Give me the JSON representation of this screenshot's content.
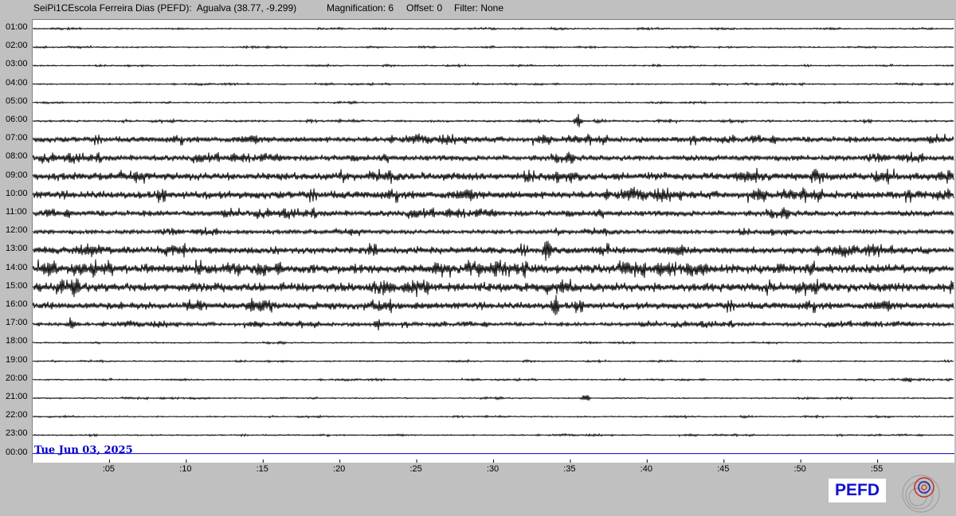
{
  "header": {
    "station": "SeiPi1CEscola Ferreira Dias (PEFD):  Agualva (38.77, -9.299)",
    "magnification": "Magnification: 6",
    "offset": "Offset: 0",
    "filter": "Filter: None"
  },
  "logo_text": "PEFD",
  "colors": {
    "background": "#c0c0c0",
    "plot_background": "#ffffff",
    "trace": "#000000",
    "current_line": "#0000cc",
    "date_text": "#0000cc",
    "logo_text": "#1010d0"
  },
  "icons": {
    "seal": "seismic-wave-seal-icon"
  },
  "chart_data": {
    "type": "line",
    "title": "",
    "xlabel": "",
    "ylabel": "",
    "date_label": "Tue Jun 03, 2025",
    "hours": [
      "01:00",
      "02:00",
      "03:00",
      "04:00",
      "05:00",
      "06:00",
      "07:00",
      "08:00",
      "09:00",
      "10:00",
      "11:00",
      "12:00",
      "13:00",
      "14:00",
      "15:00",
      "16:00",
      "17:00",
      "18:00",
      "19:00",
      "20:00",
      "21:00",
      "22:00",
      "23:00",
      "00:00"
    ],
    "minute_ticks": [
      ":05",
      ":10",
      ":15",
      ":20",
      ":25",
      ":30",
      ":35",
      ":40",
      ":45",
      ":50",
      ":55"
    ],
    "minute_tick_values": [
      5,
      10,
      15,
      20,
      25,
      30,
      35,
      40,
      45,
      50,
      55
    ],
    "xlim": [
      0,
      60
    ],
    "noise_amplitude_by_hour": [
      1.0,
      1.0,
      1.0,
      1.0,
      1.0,
      1.5,
      4.5,
      4.5,
      6.0,
      6.0,
      4.5,
      3.5,
      5.5,
      7.0,
      7.0,
      5.5,
      3.0,
      1.0,
      1.0,
      1.0,
      1.0,
      1.0,
      1.0,
      0
    ],
    "events": [
      {
        "hour": "06:00",
        "minute": 35.5,
        "amplitude": 9
      },
      {
        "hour": "13:00",
        "minute": 33.5,
        "amplitude": 12
      },
      {
        "hour": "16:00",
        "minute": 34.0,
        "amplitude": 12
      },
      {
        "hour": "17:00",
        "minute": 2.5,
        "amplitude": 8
      },
      {
        "hour": "17:00",
        "minute": 22.5,
        "amplitude": 7
      },
      {
        "hour": "21:00",
        "minute": 36.0,
        "amplitude": 6
      },
      {
        "hour": "20:00",
        "minute": 57.0,
        "amplitude": 5
      }
    ],
    "current_time": {
      "hour": "00:00",
      "minute": 0
    }
  }
}
